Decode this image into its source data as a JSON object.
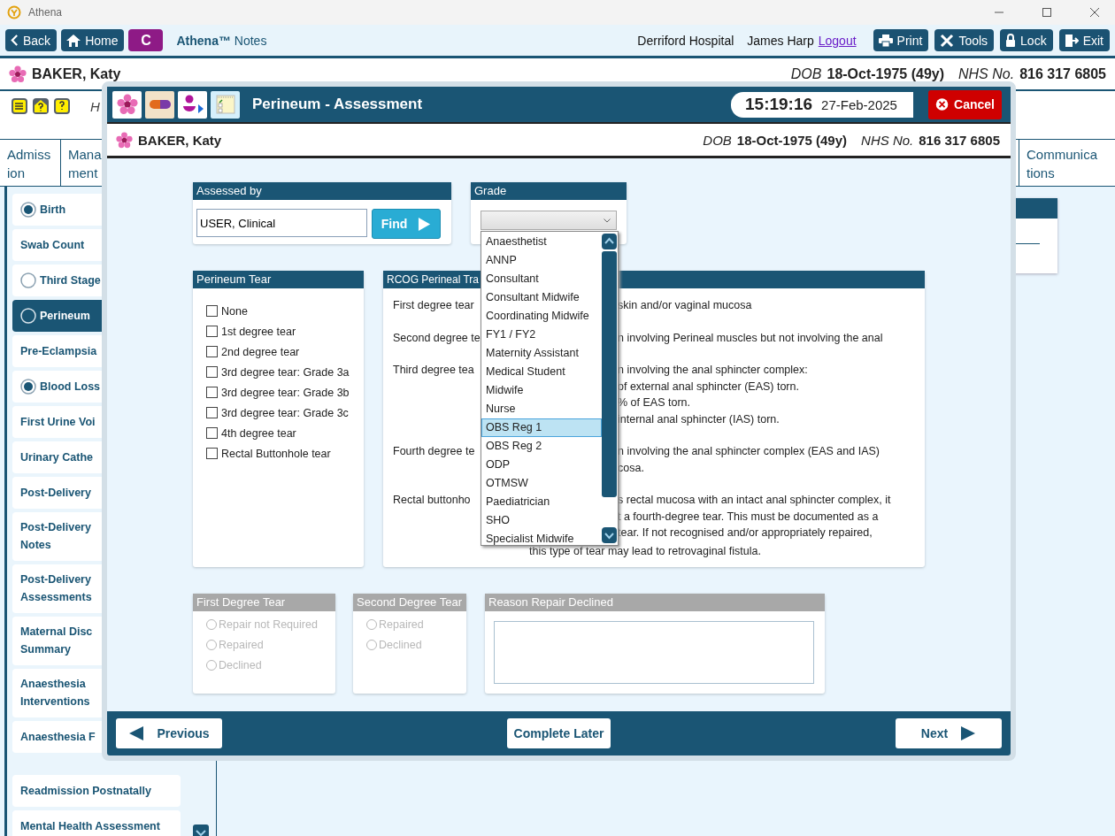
{
  "window": {
    "title": "Athena"
  },
  "toolbar": {
    "back": "Back",
    "home": "Home",
    "badge": "C",
    "app_name": "Athena™",
    "app_suffix": "Notes",
    "hospital": "Derriford Hospital",
    "user": "James Harp",
    "logout": "Logout",
    "buttons": [
      {
        "label": "Print",
        "kind": "print"
      },
      {
        "label": "Tools",
        "kind": "tools"
      },
      {
        "label": "Lock",
        "kind": "lock"
      },
      {
        "label": "Exit",
        "kind": "exit"
      }
    ]
  },
  "patient": {
    "name": "BAKER, Katy",
    "dob_label": "DOB",
    "dob": "18-Oct-1975 (49y)",
    "nhs_label": "NHS No.",
    "nhs": "816 317 6805"
  },
  "alerts": {
    "text": "H"
  },
  "tabs": [
    {
      "lines": [
        "Admiss",
        "ion"
      ]
    },
    {
      "lines": [
        "Mana",
        "ment"
      ]
    },
    {
      "lines": [
        "Communica",
        "tions"
      ]
    }
  ],
  "sidebar": {
    "groups": [
      {
        "items": [
          {
            "label": "Birth",
            "kind": "radio",
            "checked": true,
            "selected": false
          },
          {
            "label": "Swab Count",
            "kind": "plain",
            "selected": false
          },
          {
            "label": "Third Stage",
            "kind": "radio",
            "checked": false,
            "selected": false
          },
          {
            "label": "Perineum",
            "kind": "radio",
            "checked": false,
            "selected": true
          },
          {
            "label": "Pre-Eclampsia",
            "kind": "plain",
            "selected": false
          },
          {
            "label": "Blood Loss",
            "kind": "radio",
            "checked": true,
            "selected": false
          },
          {
            "label": "First Urine Voi",
            "kind": "plain",
            "selected": false
          },
          {
            "label": "Urinary Cathe",
            "kind": "plain",
            "selected": false
          },
          {
            "label": "Post-Delivery",
            "kind": "plain",
            "selected": false
          },
          {
            "label": "Post-Delivery Notes",
            "kind": "plain",
            "selected": false
          },
          {
            "label": "Post-Delivery Assessments",
            "kind": "plain",
            "selected": false
          },
          {
            "label": "Maternal Disc Summary",
            "kind": "plain",
            "selected": false
          },
          {
            "label": "Anaesthesia Interventions",
            "kind": "plain",
            "selected": false
          },
          {
            "label": "Anaesthesia F",
            "kind": "plain",
            "selected": false
          }
        ]
      },
      {
        "items": [
          {
            "label": "Readmission Postnatally",
            "kind": "plain",
            "selected": false
          },
          {
            "label": "Mental Health Assessment",
            "kind": "plain",
            "selected": false
          }
        ]
      }
    ]
  },
  "modal": {
    "title": "Perineum - Assessment",
    "time": "15:19:16",
    "date": "27-Feb-2025",
    "cancel": "Cancel",
    "patient": {
      "name": "BAKER, Katy",
      "dob_label": "DOB",
      "dob": "18-Oct-1975 (49y)",
      "nhs_label": "NHS No.",
      "nhs": "816 317 6805"
    },
    "assessed_by": {
      "title": "Assessed by",
      "value": "USER, Clinical",
      "find": "Find"
    },
    "grade": {
      "title": "Grade",
      "open": true,
      "options": [
        {
          "label": "Anaesthetist",
          "selected": false
        },
        {
          "label": "ANNP",
          "selected": false
        },
        {
          "label": "Consultant",
          "selected": false
        },
        {
          "label": "Consultant Midwife",
          "selected": false
        },
        {
          "label": "Coordinating Midwife",
          "selected": false
        },
        {
          "label": "FY1 / FY2",
          "selected": false
        },
        {
          "label": "Maternity Assistant",
          "selected": false
        },
        {
          "label": "Medical Student",
          "selected": false
        },
        {
          "label": "Midwife",
          "selected": false
        },
        {
          "label": "Nurse",
          "selected": false
        },
        {
          "label": "OBS Reg 1",
          "selected": true
        },
        {
          "label": "OBS Reg 2",
          "selected": false
        },
        {
          "label": "ODP",
          "selected": false
        },
        {
          "label": "OTMSW",
          "selected": false
        },
        {
          "label": "Paediatrician",
          "selected": false
        },
        {
          "label": "SHO",
          "selected": false
        },
        {
          "label": "Specialist Midwife",
          "selected": false
        }
      ]
    },
    "perineum_tear": {
      "title": "Perineum Tear",
      "options": [
        {
          "label": "None",
          "checked": false
        },
        {
          "label": "1st degree tear",
          "checked": false
        },
        {
          "label": "2nd degree tear",
          "checked": false
        },
        {
          "label": "3rd degree tear: Grade 3a",
          "checked": false
        },
        {
          "label": "3rd degree tear: Grade 3b",
          "checked": false
        },
        {
          "label": "3rd degree tear: Grade 3c",
          "checked": false
        },
        {
          "label": "4th degree tear",
          "checked": false
        },
        {
          "label": "Rectal Buttonhole tear",
          "checked": false
        }
      ]
    },
    "rcog": {
      "title": "RCOG Perineal Tra",
      "rows": [
        {
          "label": "First degree tear",
          "lines": [
            {
              "text": "skin and/or vaginal mucosa",
              "kind": "fragment"
            }
          ]
        },
        {
          "label": "Second degree te",
          "lines": [
            {
              "text": "n involving Perineal muscles but not involving the anal",
              "kind": "fragment"
            }
          ]
        },
        {
          "label": "Third degree tea",
          "lines": [
            {
              "text": "n involving the anal sphincter complex:",
              "kind": "fragment"
            },
            {
              "text": "of external anal sphincter (EAS) torn.",
              "kind": "fragment"
            },
            {
              "text": "% of EAS torn.",
              "kind": "fragment"
            },
            {
              "text": "internal anal sphincter (IAS) torn.",
              "kind": "fragment"
            }
          ]
        },
        {
          "label": "Fourth degree te",
          "lines": [
            {
              "text": "n involving the anal sphincter complex (EAS and IAS)",
              "kind": "fragment"
            },
            {
              "text": "cosa.",
              "kind": "fragment"
            }
          ]
        },
        {
          "label": "Rectal buttonho",
          "lines": [
            {
              "text": "s rectal mucosa with an intact anal sphincter complex, it",
              "kind": "fragment"
            },
            {
              "text": "t a fourth-degree tear.  This must be documented as a",
              "kind": "fragment"
            },
            {
              "text": "tear. If not recognised and/or appropriately repaired,",
              "kind": "fragment"
            },
            {
              "text": "this type of tear may lead to retrovaginal fistula.",
              "kind": "full"
            }
          ]
        }
      ]
    },
    "first_degree": {
      "title": "First Degree Tear",
      "disabled": true,
      "options": [
        {
          "label": "Repair not Required",
          "selected": false
        },
        {
          "label": "Repaired",
          "selected": false
        },
        {
          "label": "Declined",
          "selected": false
        }
      ]
    },
    "second_degree": {
      "title": "Second Degree Tear",
      "disabled": true,
      "options": [
        {
          "label": "Repaired",
          "selected": false
        },
        {
          "label": "Declined",
          "selected": false
        }
      ]
    },
    "reason": {
      "title": "Reason Repair Declined",
      "disabled": true
    },
    "footer": {
      "previous": "Previous",
      "complete_later": "Complete Later",
      "next": "Next"
    }
  }
}
